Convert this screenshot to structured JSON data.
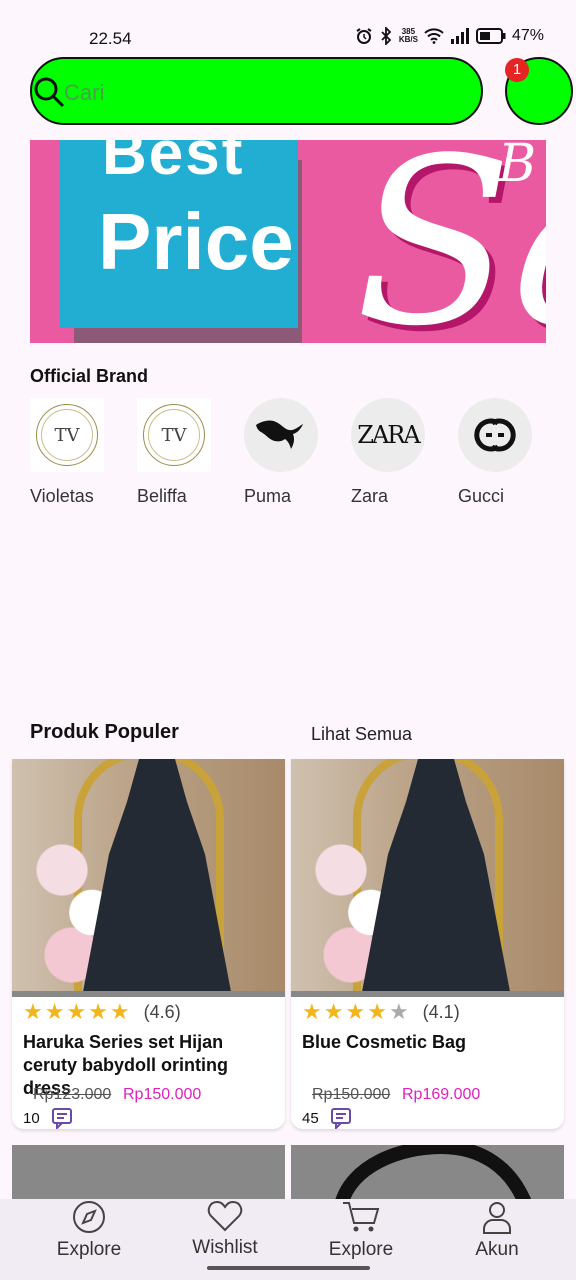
{
  "status_bar": {
    "time": "22.54",
    "net_speed": "385",
    "net_unit": "KB/S",
    "battery": "47%"
  },
  "header": {
    "search_placeholder": "Cari",
    "cart_badge": "1",
    "accent": "#00ff00"
  },
  "banner": {
    "line1": "Best",
    "line2": "Price",
    "script": "Sa",
    "script_small": "B"
  },
  "official_brand": {
    "title": "Official Brand",
    "brands": [
      {
        "name": "Violetas",
        "logo": "TV"
      },
      {
        "name": "Beliffa",
        "logo": "TV"
      },
      {
        "name": "Puma",
        "logo": "puma-icon"
      },
      {
        "name": "Zara",
        "logo": "ZARA"
      },
      {
        "name": "Gucci",
        "logo": "gucci-icon"
      }
    ]
  },
  "popular": {
    "title": "Produk Populer",
    "see_all": "Lihat Semua",
    "products": [
      {
        "rating": "(4.6)",
        "stars": 4.6,
        "name": "Haruka Series set Hijan ceruty babydoll orinting dress",
        "old_price": "Rp123.000",
        "price": "Rp150.000",
        "reviews": "10"
      },
      {
        "rating": "(4.1)",
        "stars": 4.1,
        "name": "Blue Cosmetic Bag",
        "old_price": "Rp150.000",
        "price": "Rp169.000",
        "reviews": "45"
      }
    ]
  },
  "bottom_nav": {
    "items": [
      {
        "label": "Explore",
        "icon": "compass-icon"
      },
      {
        "label": "Wishlist",
        "icon": "heart-icon"
      },
      {
        "label": "Explore",
        "icon": "cart-icon"
      },
      {
        "label": "Akun",
        "icon": "user-icon"
      }
    ]
  }
}
